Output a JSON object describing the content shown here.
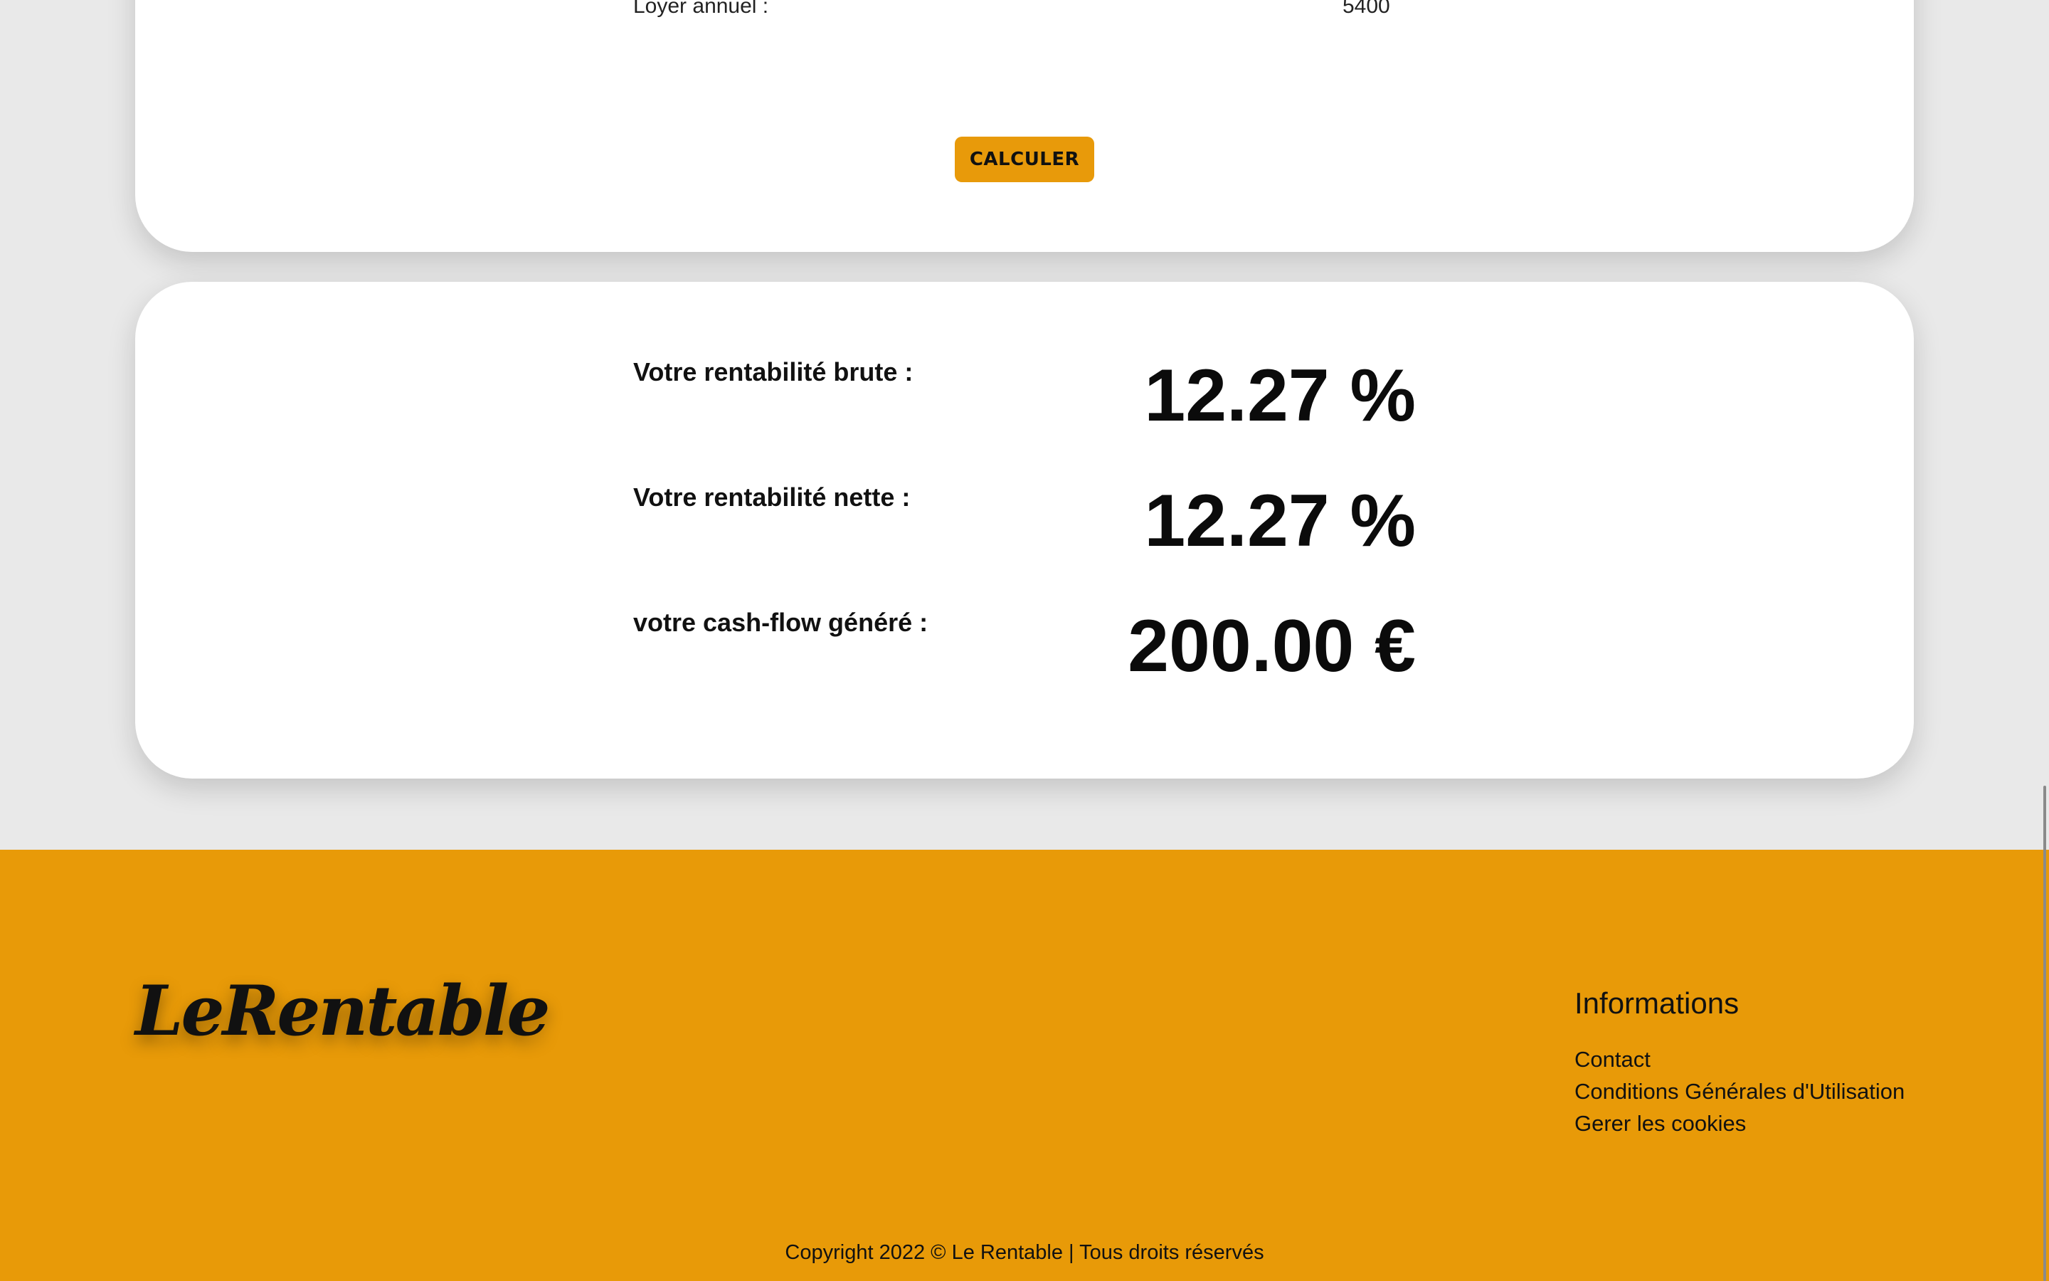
{
  "form": {
    "loyer_label": "Loyer annuel :",
    "loyer_value": "5400",
    "calculate_button": "CALCULER"
  },
  "results": {
    "brute_label": "Votre rentabilité brute :",
    "brute_value": "12.27 %",
    "nette_label": "Votre rentabilité nette :",
    "nette_value": "12.27 %",
    "cashflow_label": "votre cash-flow généré :",
    "cashflow_value": "200.00 €"
  },
  "footer": {
    "logo": "LeRentable",
    "info_title": "Informations",
    "links": [
      "Contact",
      "Conditions Générales d'Utilisation",
      "Gerer les cookies"
    ],
    "copyright": "Copyright 2022 © Le Rentable | Tous droits réservés"
  },
  "colors": {
    "accent": "#e89a08",
    "background": "#e9e9e9",
    "card": "#ffffff"
  }
}
